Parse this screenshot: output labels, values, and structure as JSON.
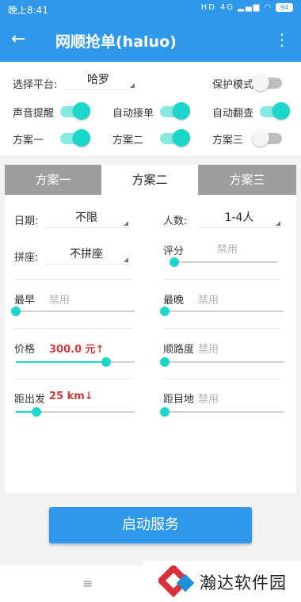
{
  "status": {
    "time": "晚上8:41",
    "network": "HD 4G",
    "battery": "94"
  },
  "app": {
    "title": "网顺抢单(haluo)"
  },
  "platform": {
    "label": "选择平台:",
    "value": "哈罗"
  },
  "options": {
    "protect_mode": {
      "label": "保护模式",
      "on": false
    },
    "sound_alert": {
      "label": "声音提醒",
      "on": true
    },
    "auto_accept": {
      "label": "自动接单",
      "on": true
    },
    "auto_flip": {
      "label": "自动翻查",
      "on": true
    },
    "plan1": {
      "label": "方案一",
      "on": true
    },
    "plan2": {
      "label": "方案二",
      "on": true
    },
    "plan3": {
      "label": "方案三",
      "on": false
    }
  },
  "tabs": [
    "方案一",
    "方案二",
    "方案三"
  ],
  "active_tab": 1,
  "filters": {
    "date": {
      "label": "日期:",
      "value": "不限"
    },
    "people": {
      "label": "人数:",
      "value": "1-4人"
    },
    "carpool": {
      "label": "拼座:",
      "value": "不拼座"
    },
    "rating": {
      "label": "评分",
      "value": "禁用",
      "level": 0
    },
    "earliest": {
      "label": "最早",
      "value": "禁用",
      "level": 0
    },
    "latest": {
      "label": "最晚",
      "value": "禁用",
      "level": 0
    },
    "price": {
      "label": "价格",
      "value": "300.0 元↑",
      "level": 0.76
    },
    "route_match": {
      "label": "顺路度",
      "value": "禁用",
      "level": 0
    },
    "departure_dist": {
      "label": "距出发",
      "value": "25 km↓",
      "level": 0.17
    },
    "destination_dist": {
      "label": "距目地",
      "value": "禁用",
      "level": 0
    }
  },
  "start_button": "启动服务",
  "nav": {
    "menu_icon": "≡"
  },
  "watermark": {
    "text": "瀚达软件园"
  },
  "colors": {
    "primary": "#2f98eb",
    "accent": "#1bd6cb",
    "highlight": "#d23b3b"
  }
}
